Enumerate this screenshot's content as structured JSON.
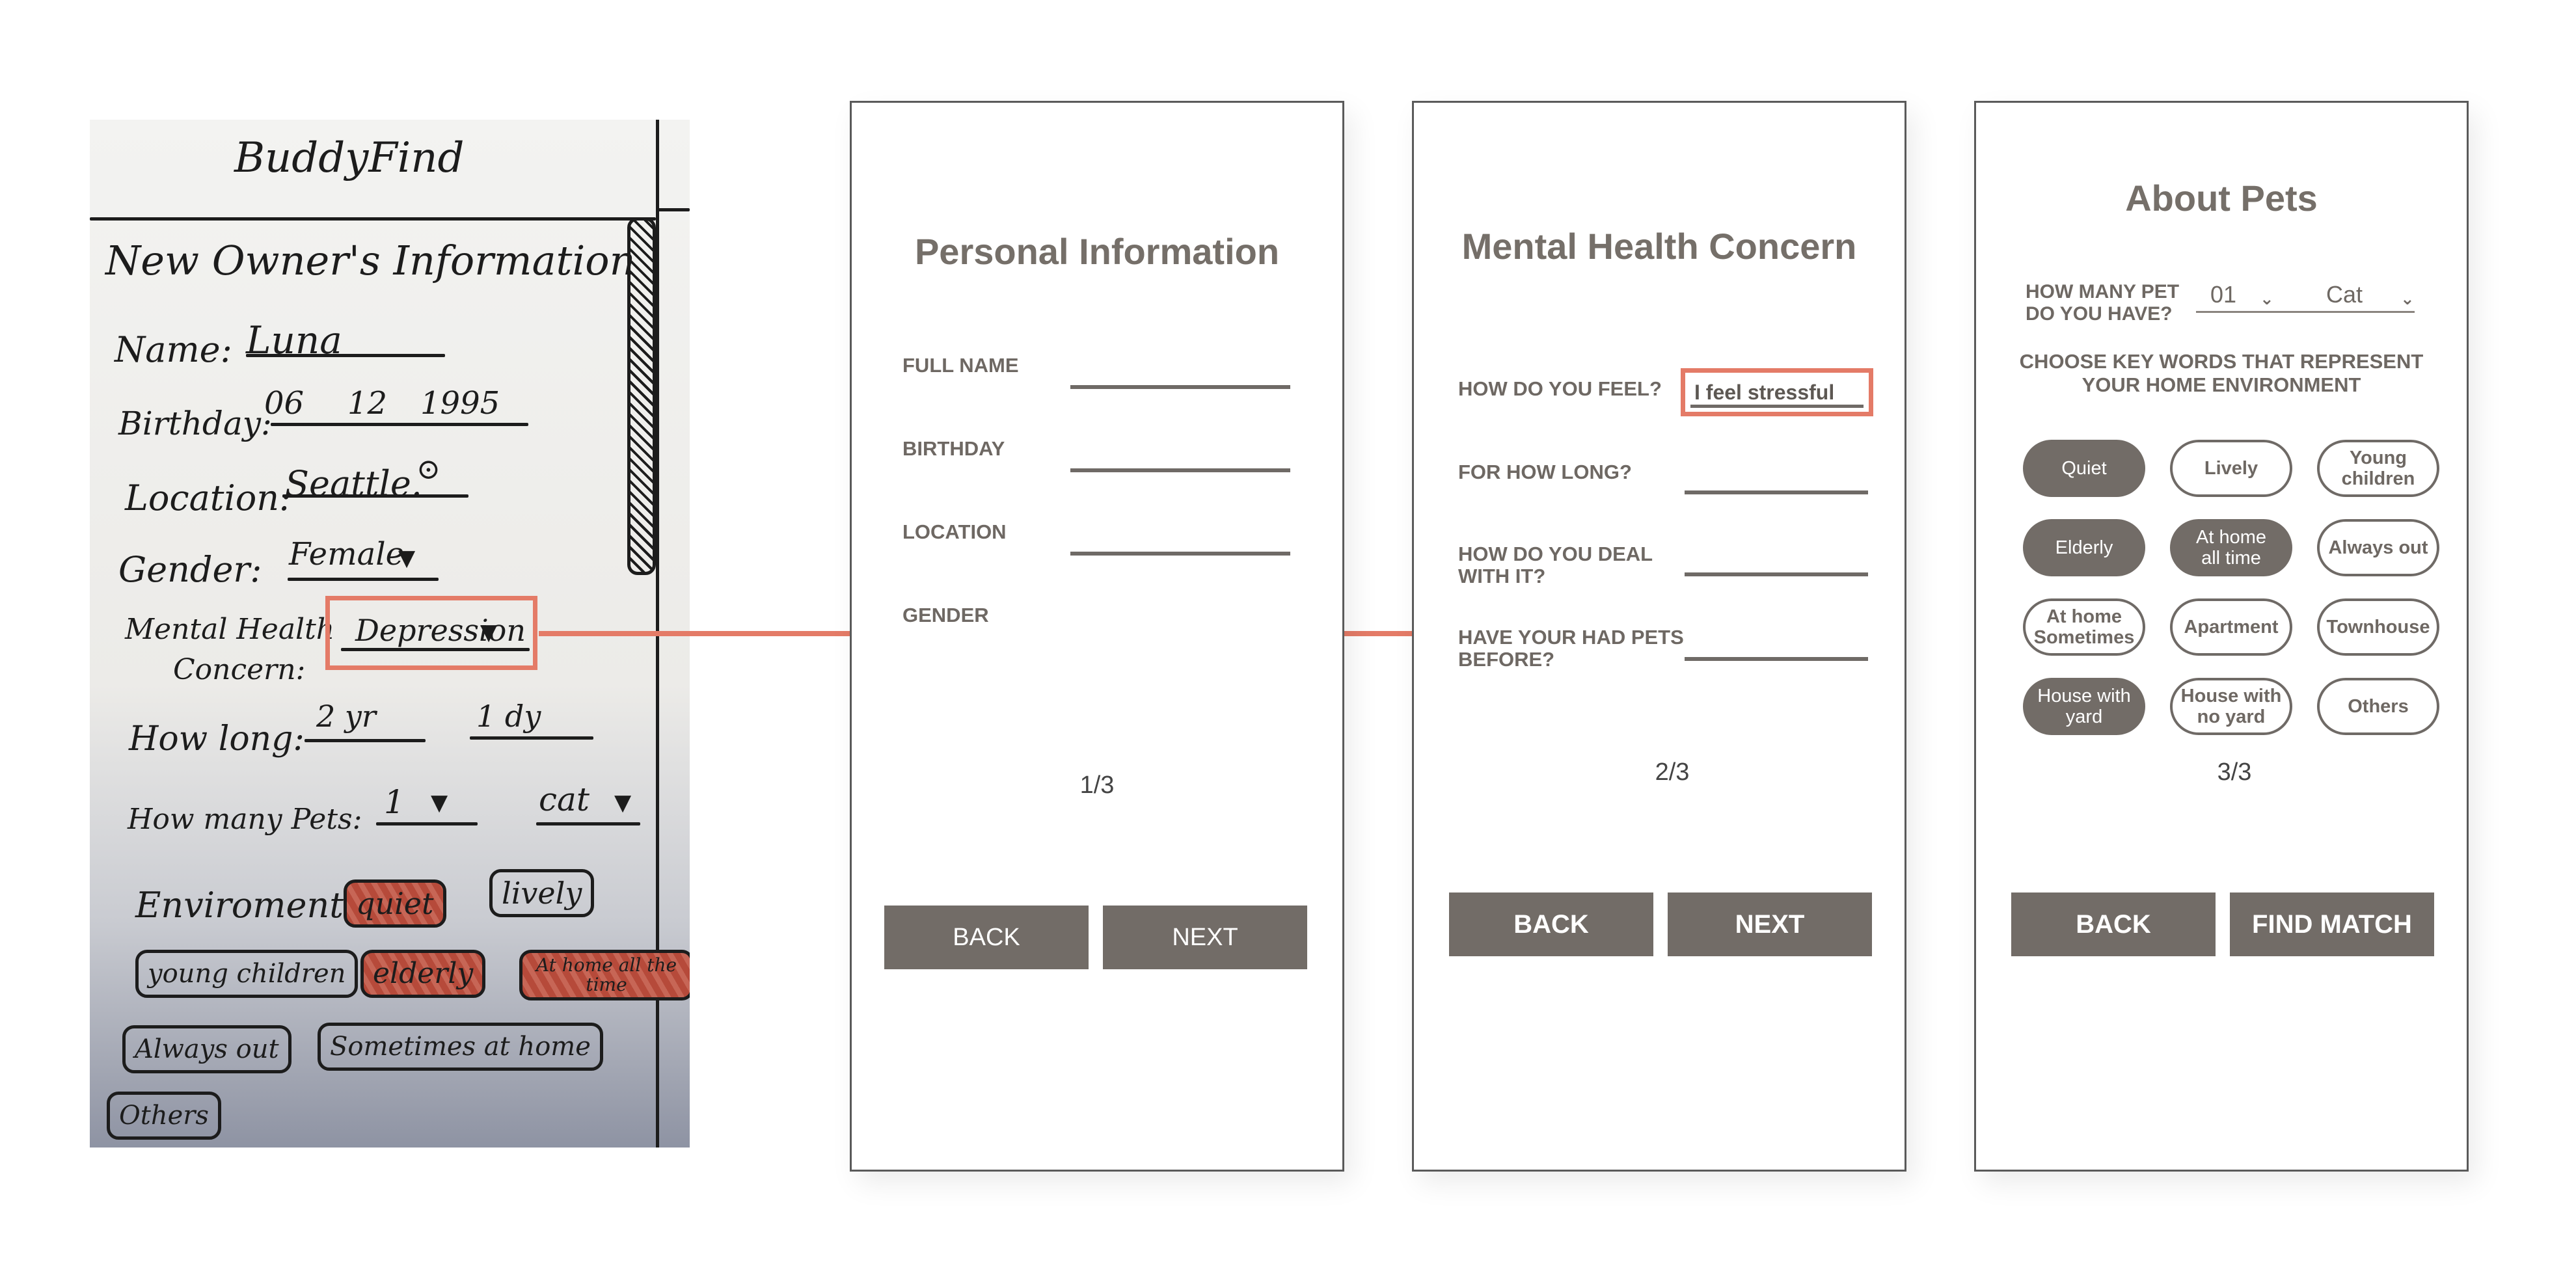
{
  "sketch": {
    "logo": "BuddyFind",
    "heading": "New Owner's Information",
    "name_label": "Name:",
    "name_value": "Luna",
    "birthday_label": "Birthday:",
    "birthday_month": "06",
    "birthday_day": "12",
    "birthday_year": "1995",
    "location_label": "Location:",
    "location_value": "Seattle.",
    "gender_label": "Gender:",
    "gender_value": "Female",
    "concern_label_1": "Mental Health",
    "concern_label_2": "Concern:",
    "concern_value": "Depression",
    "howlong_label": "How long:",
    "howlong_years": "2 yr",
    "howlong_days": "1 dy",
    "pets_label": "How many Pets:",
    "pets_count": "1",
    "pets_type": "cat",
    "env_label": "Enviroment:",
    "chips": [
      "quiet",
      "lively",
      "young children",
      "elderly",
      "At home all the time",
      "Always out",
      "Sometimes at home",
      "Others"
    ]
  },
  "screen1": {
    "title": "Personal Information",
    "fields": [
      "FULL NAME",
      "BIRTHDAY",
      "LOCATION",
      "GENDER"
    ],
    "page": "1/3",
    "back": "BACK",
    "next": "NEXT"
  },
  "screen2": {
    "title": "Mental Health Concern",
    "q1": "HOW DO YOU FEEL?",
    "q1_value": "I feel stressful",
    "q2": "FOR HOW LONG?",
    "q3_1": "HOW DO YOU DEAL",
    "q3_2": "WITH IT?",
    "q4_1": "HAVE YOUR HAD PETS",
    "q4_2": "BEFORE?",
    "page": "2/3",
    "back": "BACK",
    "next": "NEXT"
  },
  "screen3": {
    "title": "About Pets",
    "q_pets_1": "HOW MANY PET",
    "q_pets_2": "DO YOU HAVE?",
    "count_value": "01",
    "type_value": "Cat",
    "keywords_1": "CHOOSE KEY WORDS THAT REPRESENT",
    "keywords_2": "YOUR HOME ENVIRONMENT",
    "kw": {
      "quiet": "Quiet",
      "lively": "Lively",
      "young_1": "Young",
      "young_2": "children",
      "elderly": "Elderly",
      "athome_1": "At home",
      "athome_2": "all time",
      "always": "Always out",
      "sometimes_1": "At home",
      "sometimes_2": "Sometimes",
      "apartment": "Apartment",
      "townhouse": "Townhouse",
      "yard_1": "House with",
      "yard_2": "yard",
      "noyard_1": "House with",
      "noyard_2": "no yard",
      "others": "Others"
    },
    "page": "3/3",
    "back": "BACK",
    "find": "FIND MATCH"
  },
  "colors": {
    "accent": "#e47b67",
    "button": "#726c67",
    "text": "#6e6863"
  }
}
